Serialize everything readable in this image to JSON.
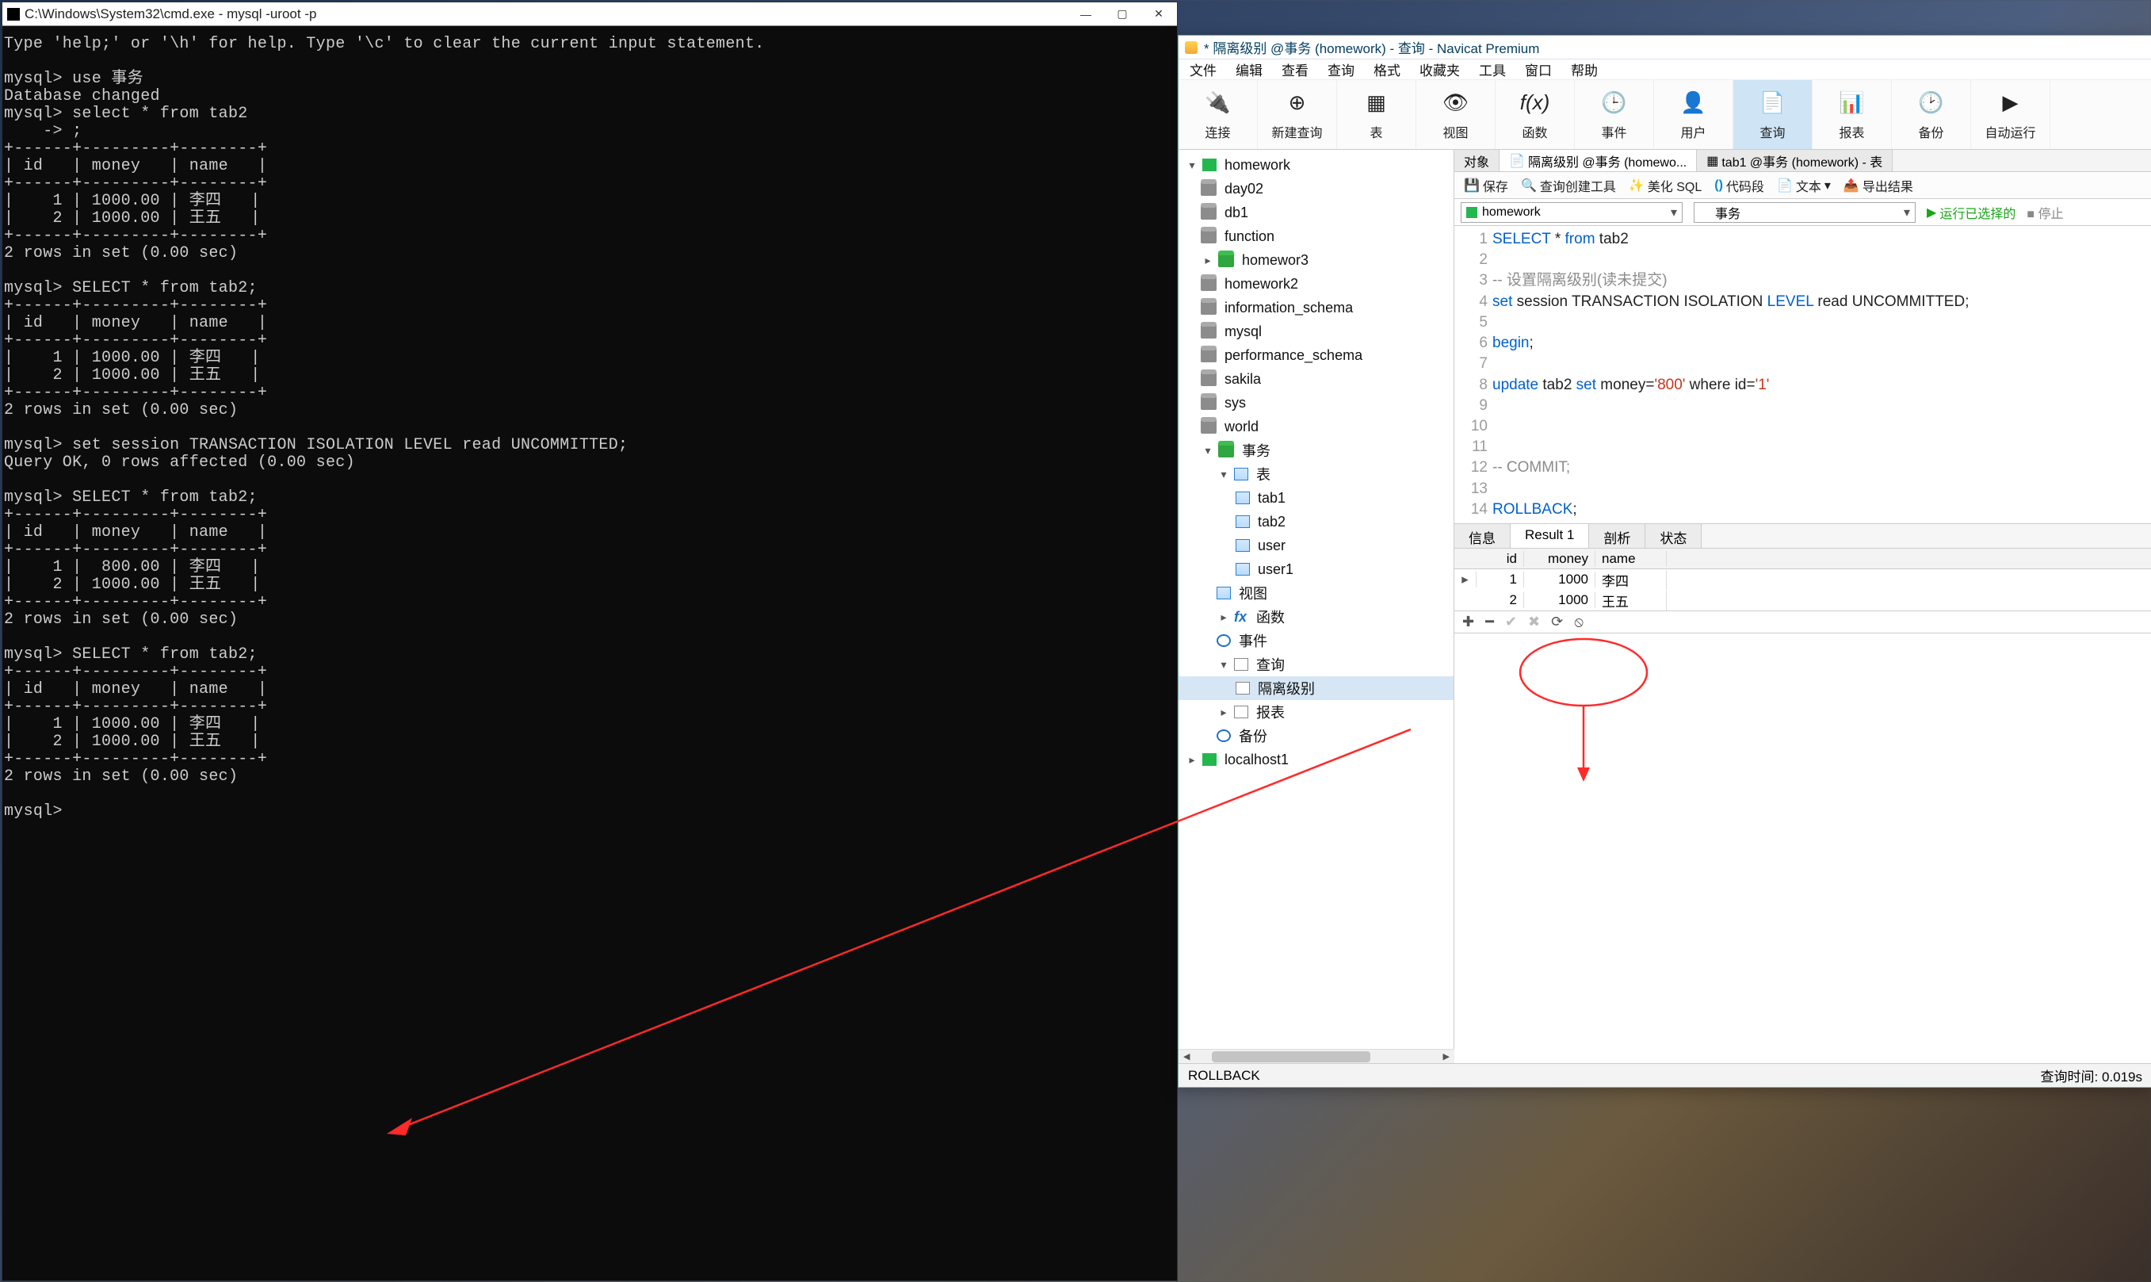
{
  "cmd": {
    "title": "C:\\Windows\\System32\\cmd.exe - mysql  -uroot -p",
    "body": "Type 'help;' or '\\h' for help. Type '\\c' to clear the current input statement.\n\nmysql> use 事务\nDatabase changed\nmysql> select * from tab2\n    -> ;\n+------+---------+--------+\n| id   | money   | name   |\n+------+---------+--------+\n|    1 | 1000.00 | 李四   |\n|    2 | 1000.00 | 王五   |\n+------+---------+--------+\n2 rows in set (0.00 sec)\n\nmysql> SELECT * from tab2;\n+------+---------+--------+\n| id   | money   | name   |\n+------+---------+--------+\n|    1 | 1000.00 | 李四   |\n|    2 | 1000.00 | 王五   |\n+------+---------+--------+\n2 rows in set (0.00 sec)\n\nmysql> set session TRANSACTION ISOLATION LEVEL read UNCOMMITTED;\nQuery OK, 0 rows affected (0.00 sec)\n\nmysql> SELECT * from tab2;\n+------+---------+--------+\n| id   | money   | name   |\n+------+---------+--------+\n|    1 |  800.00 | 李四   |\n|    2 | 1000.00 | 王五   |\n+------+---------+--------+\n2 rows in set (0.00 sec)\n\nmysql> SELECT * from tab2;\n+------+---------+--------+\n| id   | money   | name   |\n+------+---------+--------+\n|    1 | 1000.00 | 李四   |\n|    2 | 1000.00 | 王五   |\n+------+---------+--------+\n2 rows in set (0.00 sec)\n\nmysql> "
  },
  "navicat": {
    "title": "* 隔离级别 @事务 (homework) - 查询 - Navicat Premium",
    "menu": [
      "文件",
      "编辑",
      "查看",
      "查询",
      "格式",
      "收藏夹",
      "工具",
      "窗口",
      "帮助"
    ],
    "toolbar": [
      "连接",
      "新建查询",
      "表",
      "视图",
      "函数",
      "事件",
      "用户",
      "查询",
      "报表",
      "备份",
      "自动运行"
    ],
    "tree": {
      "conn": "homework",
      "dbs_grey": [
        "day02",
        "db1",
        "function",
        "homewor3",
        "homework2",
        "information_schema",
        "mysql",
        "performance_schema",
        "sakila",
        "sys",
        "world"
      ],
      "db_open": "事务",
      "cat_tables": "表",
      "tables": [
        "tab1",
        "tab2",
        "user",
        "user1"
      ],
      "cat_views": "视图",
      "cat_functions": "函数",
      "cat_events": "事件",
      "cat_queries": "查询",
      "query_sel": "隔离级别",
      "cat_reports": "报表",
      "cat_backups": "备份",
      "conn2": "localhost1"
    },
    "tabs": {
      "objects": "对象",
      "q": "隔离级别 @事务 (homewo...",
      "t": "tab1 @事务 (homework) - 表"
    },
    "mini_tb": {
      "save": "保存",
      "qcreate": "查询创建工具",
      "beautify": "美化 SQL",
      "codeseg": "代码段",
      "text": "文本",
      "export": "导出结果"
    },
    "selects": {
      "db": "homework",
      "schema": "事务",
      "run": "运行已选择的",
      "stop": "停止"
    },
    "code": {
      "l1a": "SELECT",
      "l1b": " * ",
      "l1c": "from",
      "l1d": " tab2",
      "l3": "-- 设置隔离级别(读未提交)",
      "l4a": "set",
      "l4b": " session TRANSACTION ISOLATION ",
      "l4c": "LEVEL",
      "l4d": " read UNCOMMITTED;",
      "l6": "begin",
      "l6semi": ";",
      "l8a": "update",
      "l8b": " tab2 ",
      "l8c": "set",
      "l8d": " money=",
      "l8v1": "'800'",
      "l8e": " where id=",
      "l8v2": "'1'",
      "l12": "-- COMMIT;",
      "l14": "ROLLBACK",
      "l14semi": ";"
    },
    "result_tabs": [
      "信息",
      "Result 1",
      "剖析",
      "状态"
    ],
    "grid": {
      "cols": [
        "id",
        "money",
        "name"
      ],
      "rows": [
        {
          "id": "1",
          "money": "1000",
          "name": "李四",
          "mark": "▸"
        },
        {
          "id": "2",
          "money": "1000",
          "name": "王五",
          "mark": ""
        }
      ]
    },
    "status_left": "ROLLBACK",
    "status_right": "查询时间: 0.019s"
  }
}
